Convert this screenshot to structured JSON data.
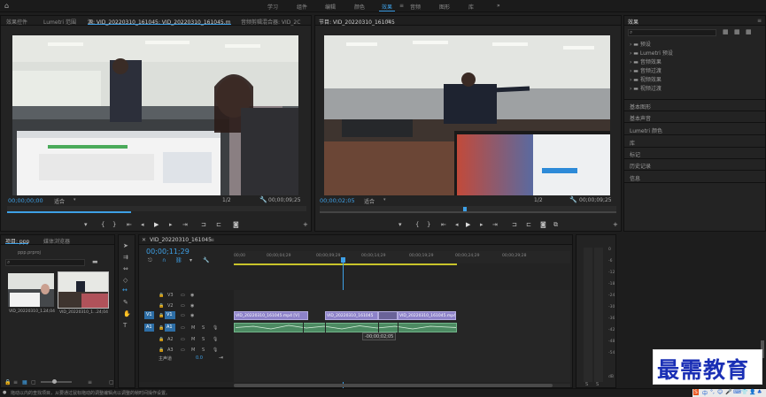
{
  "workspaces": [
    "学习",
    "组件",
    "编辑",
    "颜色",
    "效果",
    "音频",
    "图形",
    "库"
  ],
  "active_workspace": "效果",
  "source_monitor": {
    "tabs": [
      "效果控件",
      "Lumetri 范围",
      "源: VID_20220310_161045: VID_20220310_161045.mp4: 00;00;00;00",
      "音频剪辑混合器: VID_2C"
    ],
    "timecode_left": "00;00;00;00",
    "fit": "适合",
    "resolution": "1/2",
    "timecode_right": "00;00;09;25"
  },
  "program_monitor": {
    "title": "节目: VID_20220310_161045",
    "timecode_left": "00;00;02;05",
    "fit": "适合",
    "resolution": "1/2",
    "timecode_right": "00;00;09;25"
  },
  "effects_panel": {
    "title": "效果",
    "search_placeholder": "",
    "folders": [
      "预设",
      "Lumetri 预设",
      "音频效果",
      "音频过渡",
      "视频效果",
      "视频过渡"
    ],
    "sections": [
      "基本图形",
      "基本声音",
      "Lumetri 颜色",
      "库",
      "标记",
      "历史记录",
      "信息"
    ]
  },
  "project_panel": {
    "tabs": [
      "项目: ppp",
      "媒体浏览器"
    ],
    "project_name": "ppp.prproj",
    "items": [
      {
        "name": "VID_20220310_1...",
        "duration": "24;04"
      },
      {
        "name": "VID_20220310_1...",
        "duration": "24;04"
      }
    ]
  },
  "timeline": {
    "sequence_tab": "VID_20220310_161045",
    "timecode": "00;00;11;29",
    "ruler": [
      "00;00",
      "00;00;04;29",
      "00;00;09;29",
      "00;00;14;29",
      "00;00;19;29",
      "00;00;24;29",
      "00;00;29;28"
    ],
    "video_tracks": [
      "V3",
      "V2",
      "V1"
    ],
    "audio_tracks": [
      "A1",
      "A2",
      "A3"
    ],
    "master_label": "主声道",
    "master_value": "0.0",
    "track_letters": {
      "mute": "M",
      "solo": "S"
    },
    "src_patch": {
      "video": "V1",
      "audio": "A1"
    },
    "clips_v1": [
      "VID_20220310_161045.mp4 [V]",
      "VID_20220310_161045",
      "VID_20220310_161045.mp4"
    ],
    "tooltip": "-00;00;02;05"
  },
  "audio_meter": {
    "labels": [
      "0",
      "-6",
      "-12",
      "-18",
      "-24",
      "-30",
      "-36",
      "-42",
      "-48",
      "-54",
      "dB"
    ],
    "solo_labels": [
      "S",
      "S"
    ]
  },
  "status_bar": "拖动以内的查找项目，从要通过鼠标拖动的调整编辑点以调整的帧时间操作设置。",
  "watermark": {
    "text": "最需教育"
  },
  "tray_icons": [
    "S",
    "中",
    "°,",
    "😊",
    "🎤",
    "⌨",
    "👕",
    "👤",
    "♣"
  ]
}
